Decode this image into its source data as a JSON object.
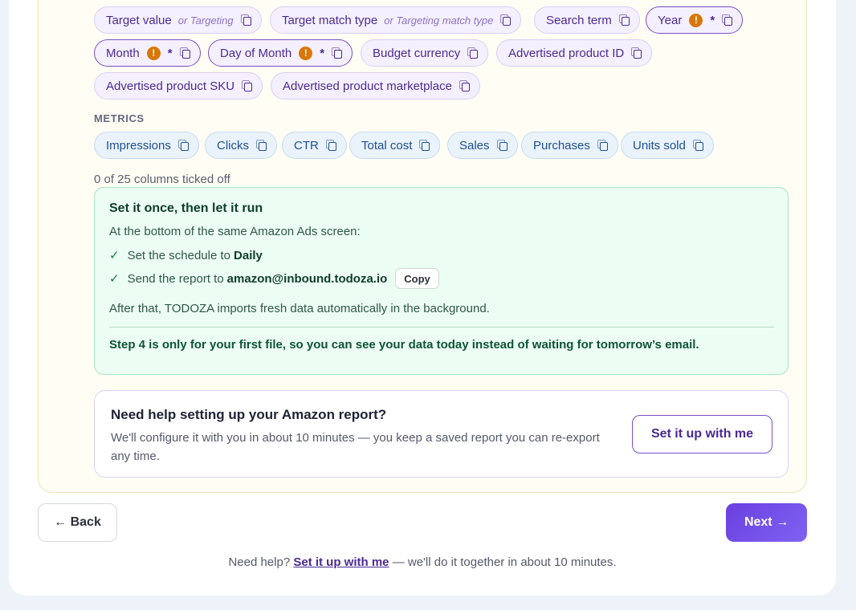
{
  "dimensions_chips": [
    {
      "label": "Target value",
      "alt": "or Targeting",
      "required": false
    },
    {
      "label": "Target match type",
      "alt": "or Targeting match type",
      "required": false
    },
    {
      "label": "Search term",
      "required": false
    },
    {
      "label": "Year",
      "required": true,
      "star": "*"
    },
    {
      "label": "Month",
      "required": true,
      "star": "*"
    },
    {
      "label": "Day of Month",
      "required": true,
      "star": "*"
    },
    {
      "label": "Budget currency",
      "required": false
    },
    {
      "label": "Advertised product ID",
      "required": false
    },
    {
      "label": "Advertised product SKU",
      "required": false
    },
    {
      "label": "Advertised product marketplace",
      "required": false
    }
  ],
  "metrics": {
    "label": "METRICS",
    "chips": [
      "Impressions",
      "Clicks",
      "CTR",
      "Total cost",
      "Sales",
      "Purchases",
      "Units sold"
    ]
  },
  "progress": {
    "text": "0 of 25 columns ticked off",
    "done": 0,
    "total": 25
  },
  "schedule_box": {
    "title": "Set it once, then let it run",
    "intro": "At the bottom of the same Amazon Ads screen:",
    "steps": [
      {
        "text": "Set the schedule to",
        "strong": "Daily"
      },
      {
        "text": "Send the report to",
        "strong": "amazon@inbound.todoza.io",
        "button": "Copy"
      }
    ],
    "after": "After that, TODOZA imports fresh data automatically in the background.",
    "note": "Step 4 is only for your first file, so you can see your data today instead of waiting for tomorrow’s email."
  },
  "help_box": {
    "title": "Need help setting up your Amazon report?",
    "description": "We'll configure it with you in about 10 minutes — you keep a saved report you can re-export any time.",
    "button": "Set it up with me"
  },
  "nav": {
    "back": "← Back",
    "next": "Next →"
  },
  "footer": {
    "prefix": "Need help?",
    "link": "Set it up with me",
    "suffix": "— we'll do it together in about 10 minutes."
  },
  "colors": {
    "accent": "#6b3fe0",
    "warning": "#d97706",
    "success": "#15803d"
  }
}
